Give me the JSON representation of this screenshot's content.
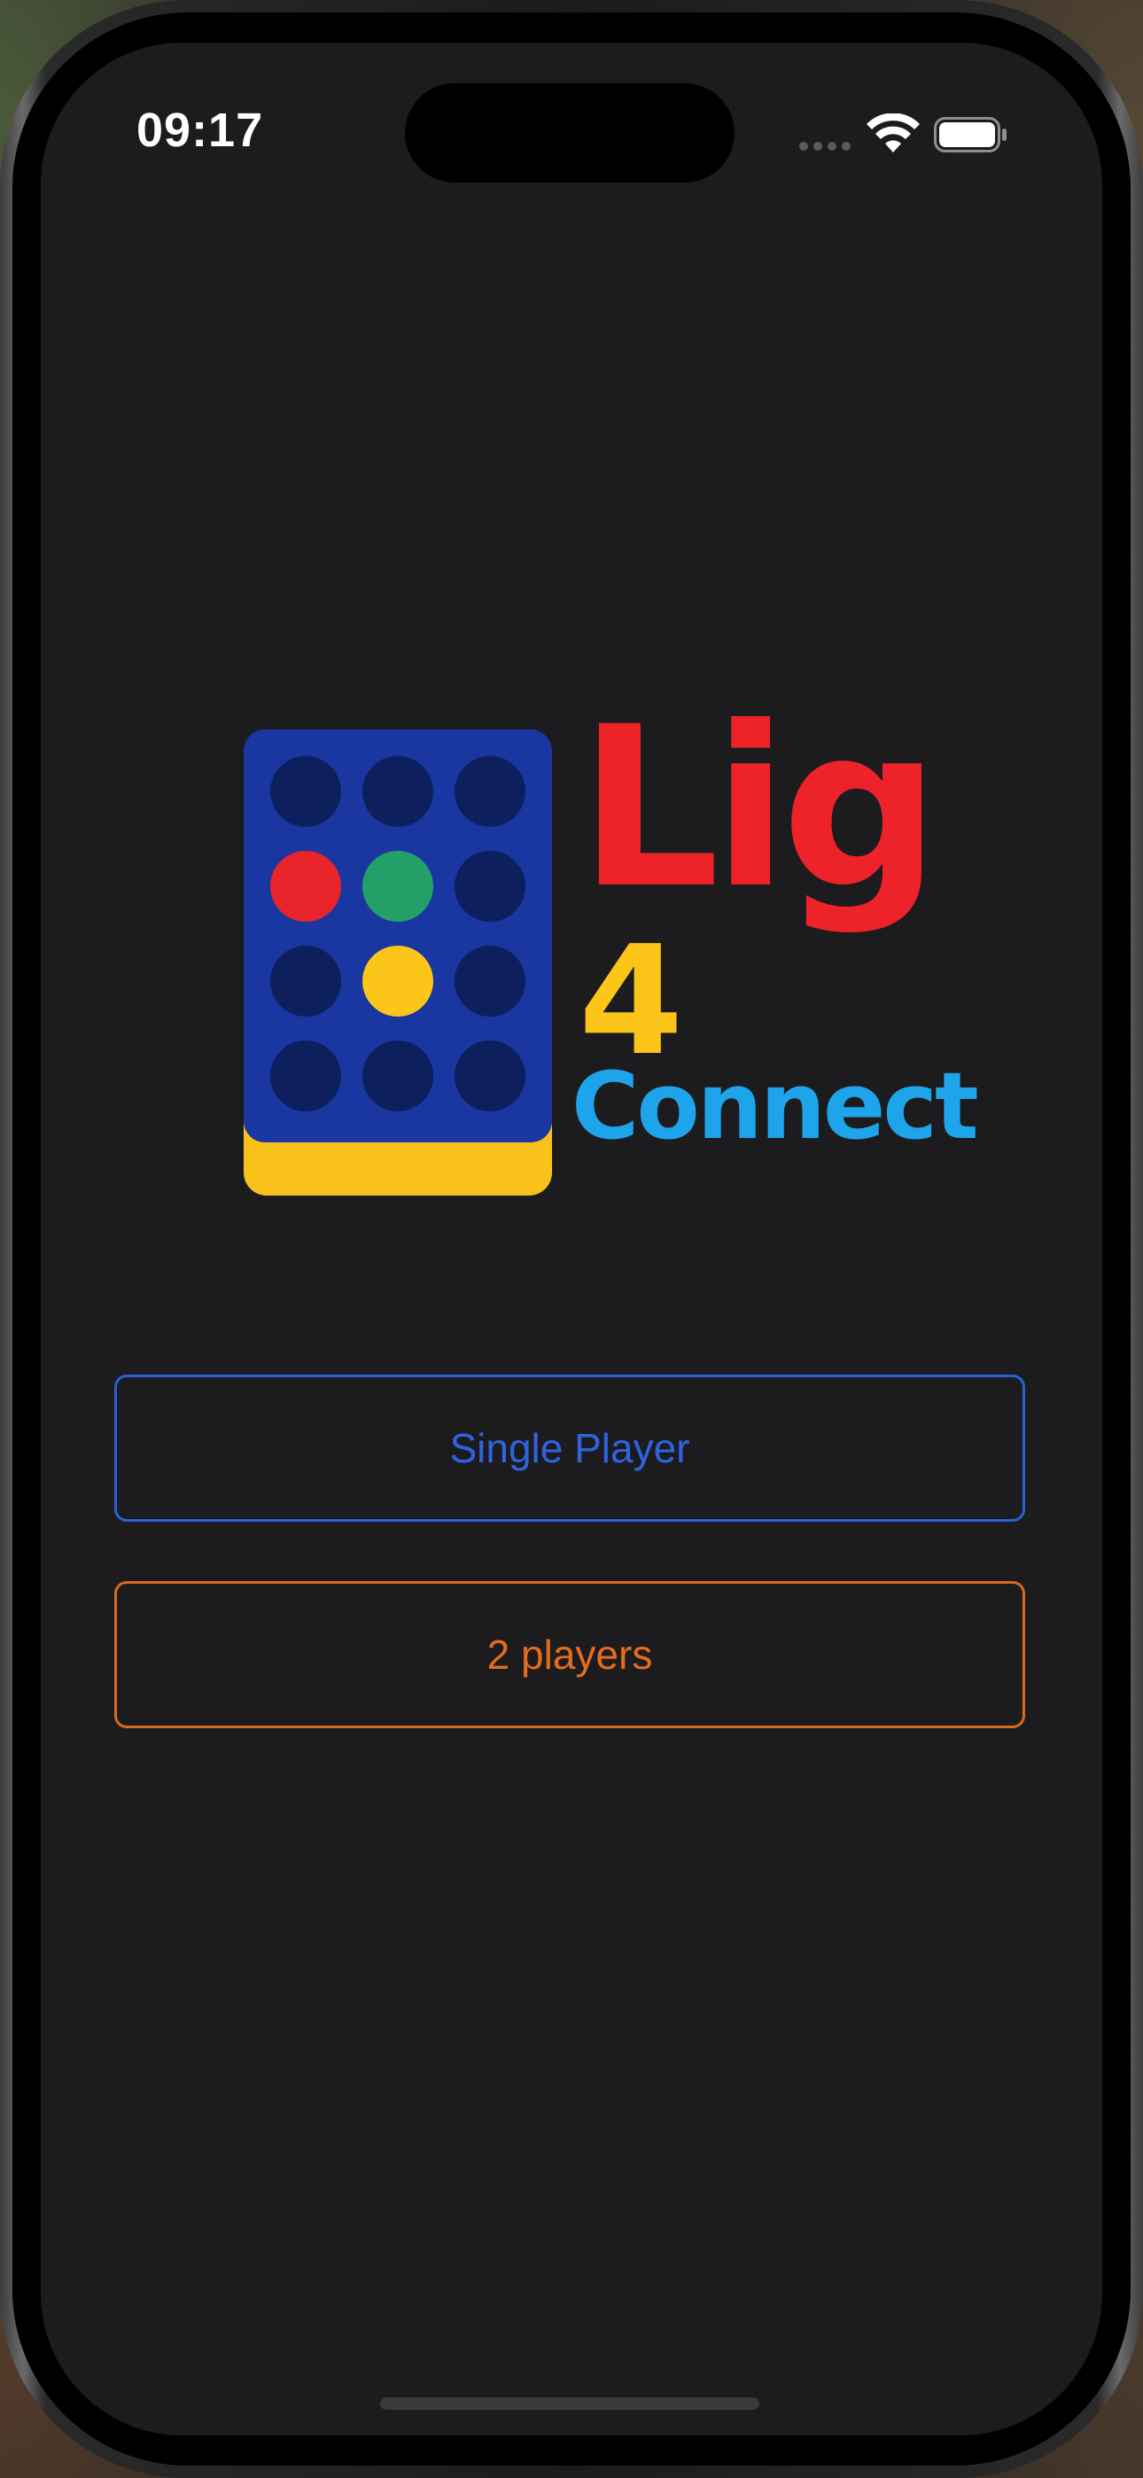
{
  "status_bar": {
    "time": "09:17"
  },
  "logo": {
    "line1": "Lig",
    "line2": "4",
    "line3": "Connect",
    "colors": {
      "board": "#1a36a0",
      "board_base": "#f9c21a",
      "empty_hole": "#0e1f5e",
      "red": "#e9242b",
      "green": "#23a068",
      "yellow": "#fcc51a",
      "lig_text": "#ee2229",
      "four_text": "#fcc51a",
      "connect_text": "#1ea4ea"
    },
    "grid": [
      [
        "empty",
        "empty",
        "empty"
      ],
      [
        "red",
        "green",
        "empty"
      ],
      [
        "empty",
        "yellow",
        "empty"
      ],
      [
        "empty",
        "empty",
        "empty"
      ]
    ]
  },
  "menu": {
    "single_player_label": "Single Player",
    "two_players_label": "2 players",
    "single_player_color": "#2f63de",
    "two_players_color": "#e36c1f"
  },
  "theme": {
    "background": "#1c1c1e"
  }
}
